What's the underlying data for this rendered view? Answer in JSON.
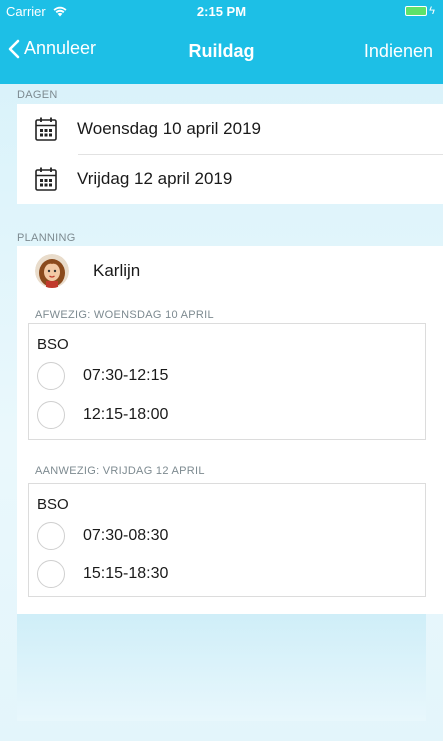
{
  "status": {
    "carrier": "Carrier",
    "time": "2:15 PM"
  },
  "nav": {
    "back_label": "Annuleer",
    "title": "Ruildag",
    "submit_label": "Indienen"
  },
  "days": {
    "section_label": "DAGEN",
    "items": [
      {
        "label": "Woensdag 10 april 2019"
      },
      {
        "label": "Vrijdag 12 april 2019"
      }
    ]
  },
  "planning": {
    "section_label": "PLANNING",
    "child_name": "Karlijn",
    "absent": {
      "label": "AFWEZIG: WOENSDAG 10 APRIL",
      "group": "BSO",
      "slots": [
        "07:30-12:15",
        "12:15-18:00"
      ]
    },
    "present": {
      "label": "AANWEZIG: VRIJDAG 12 APRIL",
      "group": "BSO",
      "slots": [
        "07:30-08:30",
        "15:15-18:30"
      ]
    }
  },
  "colors": {
    "accent": "#1dbfe6",
    "battery": "#5ee26a"
  }
}
